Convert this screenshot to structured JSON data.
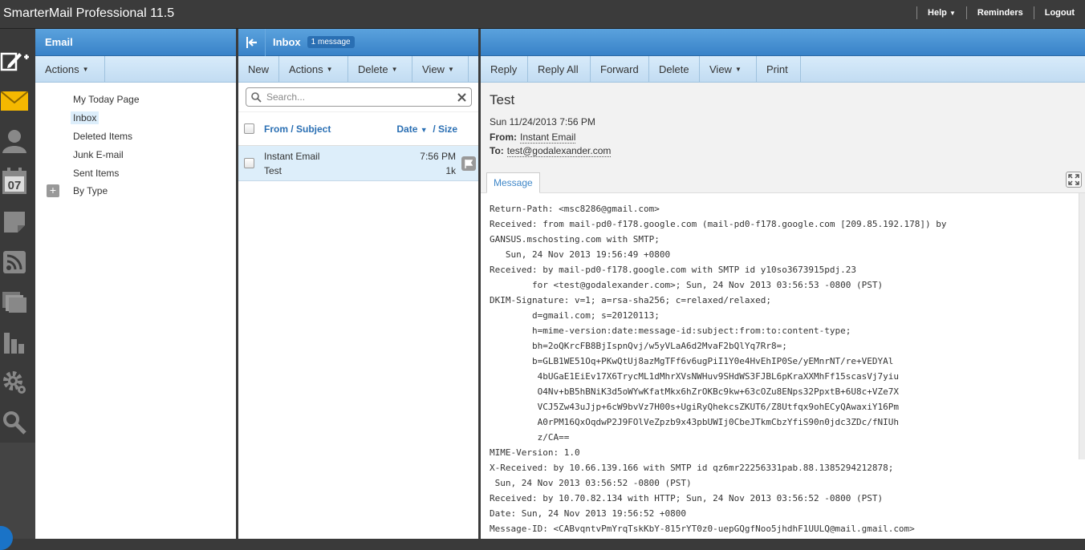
{
  "app": {
    "title": "SmarterMail Professional 11.5"
  },
  "top_links": {
    "help": "Help",
    "reminders": "Reminders",
    "logout": "Logout"
  },
  "folders": {
    "header": "Email",
    "actions_label": "Actions",
    "items": [
      {
        "label": "My Today Page"
      },
      {
        "label": "Inbox"
      },
      {
        "label": "Deleted Items"
      },
      {
        "label": "Junk E-mail"
      },
      {
        "label": "Sent Items"
      },
      {
        "label": "By Type"
      }
    ]
  },
  "list": {
    "header": "Inbox",
    "badge": "1 message",
    "toolbar": {
      "new": "New",
      "actions": "Actions",
      "delete": "Delete",
      "view": "View"
    },
    "search_placeholder": "Search...",
    "columns": {
      "from_subject": "From / Subject",
      "date": "Date",
      "size": "/ Size"
    },
    "messages": [
      {
        "from": "Instant Email",
        "subject": "Test",
        "time": "7:56 PM",
        "size": "1k"
      }
    ]
  },
  "reader": {
    "toolbar": {
      "reply": "Reply",
      "reply_all": "Reply All",
      "forward": "Forward",
      "delete": "Delete",
      "view": "View",
      "print": "Print"
    },
    "subject": "Test",
    "date": "Sun 11/24/2013 7:56 PM",
    "from_label": "From:",
    "from_value": "Instant Email",
    "to_label": "To:",
    "to_value": "test@godalexander.com",
    "tab_label": "Message",
    "body": "Return-Path: <msc8286@gmail.com>\nReceived: from mail-pd0-f178.google.com (mail-pd0-f178.google.com [209.85.192.178]) by\nGANSUS.mschosting.com with SMTP;\n   Sun, 24 Nov 2013 19:56:49 +0800\nReceived: by mail-pd0-f178.google.com with SMTP id y10so3673915pdj.23\n        for <test@godalexander.com>; Sun, 24 Nov 2013 03:56:53 -0800 (PST)\nDKIM-Signature: v=1; a=rsa-sha256; c=relaxed/relaxed;\n        d=gmail.com; s=20120113;\n        h=mime-version:date:message-id:subject:from:to:content-type;\n        bh=2oQKrcFB8BjIspnQvj/w5yVLaA6d2MvaF2bQlYq7Rr8=;\n        b=GLB1WE51Oq+PKwQtUj8azMgTFf6v6ugPiI1Y0e4HvEhIP0Se/yEMnrNT/re+VEDYAl\n         4bUGaE1EiEv17X6TrycML1dMhrXVsNWHuv9SHdWS3FJBL6pKraXXMhFf15scasVj7yiu\n         O4Nv+bB5hBNiK3d5oWYwKfatMkx6hZrOKBc9kw+63cOZu8ENps32PpxtB+6U8c+VZe7X\n         VCJ5Zw43uJjp+6cW9bvVz7H00s+UgiRyQhekcsZKUT6/Z8Utfqx9ohECyQAwaxiY16Pm\n         A0rPM16QxOqdwP2J9FOlVeZpzb9x43pbUWIj0CbeJTkmCbzYfiS90n0jdc3ZDc/fNIUh\n         z/CA==\nMIME-Version: 1.0\nX-Received: by 10.66.139.166 with SMTP id qz6mr22256331pab.88.1385294212878;\n Sun, 24 Nov 2013 03:56:52 -0800 (PST)\nReceived: by 10.70.82.134 with HTTP; Sun, 24 Nov 2013 03:56:52 -0800 (PST)\nDate: Sun, 24 Nov 2013 19:56:52 +0800\nMessage-ID: <CABvqntvPmYrqTskKbY-815rYT0z0-uepGQgfNoo5jhdhF1UULQ@mail.gmail.com>"
  },
  "rail_icons": [
    "compose-icon",
    "mail-icon",
    "contacts-icon",
    "calendar-icon",
    "notes-icon",
    "rss-icon",
    "files-icon",
    "reports-icon",
    "settings-icon",
    "search-icon"
  ],
  "calendar_day": "07",
  "colors": {
    "accent": "#3882c8",
    "toolbar": "#cfe4f6",
    "topbar": "#3b3b3b"
  }
}
